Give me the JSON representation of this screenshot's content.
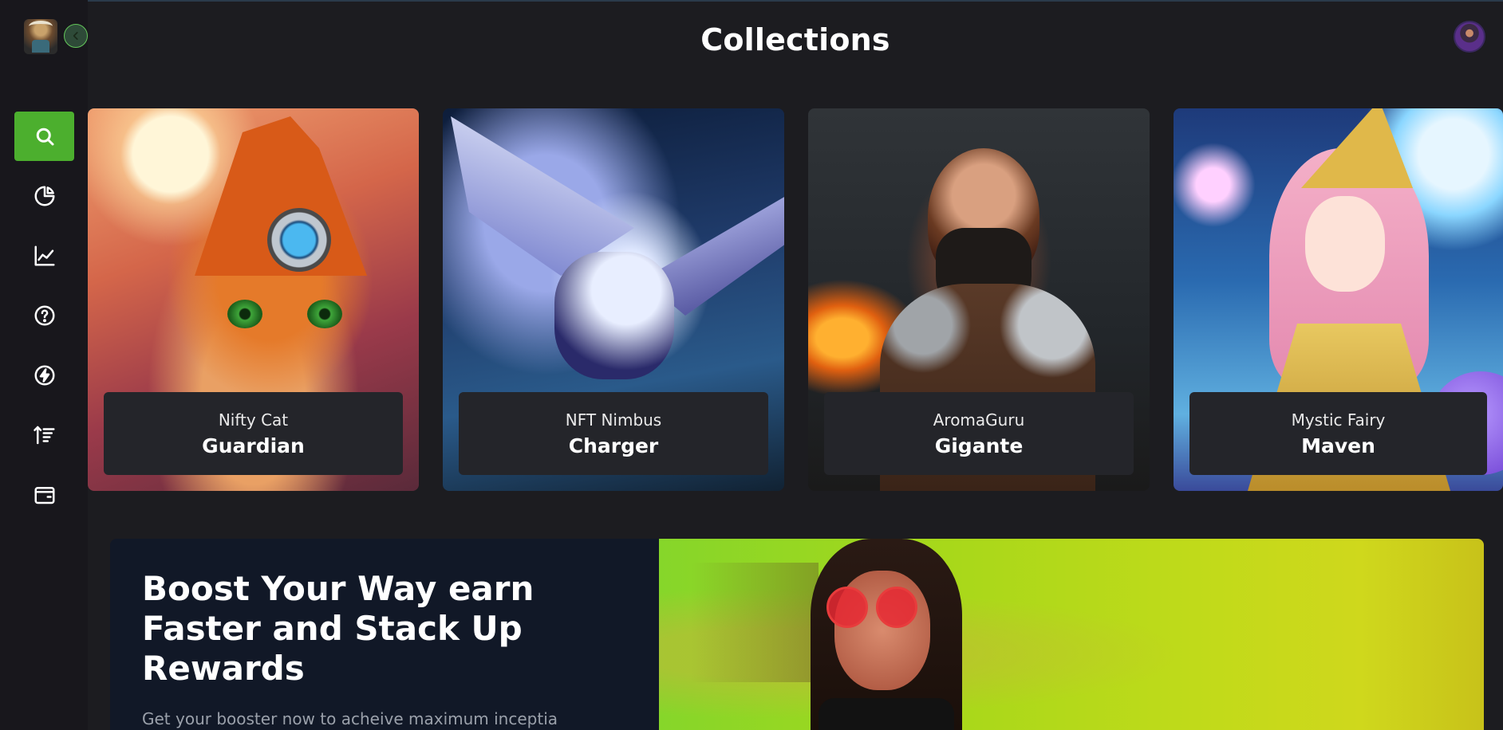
{
  "header": {
    "title": "Collections"
  },
  "sidebar": {
    "logo_name": "app-logo",
    "collapse_icon": "chevron-left-icon",
    "items": [
      {
        "id": "search",
        "icon": "search-icon",
        "active": true
      },
      {
        "id": "dashboard",
        "icon": "pie-chart-icon",
        "active": false
      },
      {
        "id": "analytics",
        "icon": "line-chart-icon",
        "active": false
      },
      {
        "id": "help",
        "icon": "help-circle-icon",
        "active": false
      },
      {
        "id": "boost",
        "icon": "lightning-icon",
        "active": false
      },
      {
        "id": "sort",
        "icon": "sort-icon",
        "active": false
      },
      {
        "id": "wallet",
        "icon": "wallet-icon",
        "active": false
      }
    ]
  },
  "colors": {
    "accent": "#4caf2e",
    "background": "#1c1c20",
    "sidebar": "#18171c",
    "card_label": "#24252a"
  },
  "collections": [
    {
      "subtitle": "Nifty Cat",
      "name": "Guardian"
    },
    {
      "subtitle": "NFT Nimbus",
      "name": "Charger"
    },
    {
      "subtitle": "AromaGuru",
      "name": "Gigante"
    },
    {
      "subtitle": "Mystic Fairy",
      "name": "Maven"
    }
  ],
  "promo": {
    "heading": "Boost Your Way earn Faster and Stack Up Rewards",
    "subtext": "Get your booster now to acheive maximum inceptia"
  }
}
